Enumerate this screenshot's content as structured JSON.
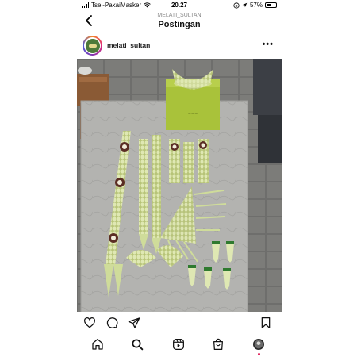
{
  "status_bar": {
    "carrier": "Tsel-PakaiMasker",
    "time": "20.27",
    "battery_text": "57%",
    "battery_level": 0.57
  },
  "header": {
    "subtitle": "MELATI_SULTAN",
    "title": "Postingan"
  },
  "post": {
    "username": "melati_sultan",
    "more_label": "•••",
    "image_subject": "jasmine-flower-bridal-accessories-on-stone-table"
  },
  "icons": {
    "back": "chevron-left-icon",
    "like": "heart-icon",
    "comment": "comment-icon",
    "share": "paper-plane-icon",
    "save": "bookmark-icon",
    "home": "home-icon",
    "search": "search-icon",
    "reels": "reels-icon",
    "shop": "shop-bag-icon",
    "profile": "profile-avatar-icon"
  },
  "colors": {
    "notification_dot": "#e0245e",
    "jasmine_green": "#cfdc9a",
    "box_green": "#a9c23a"
  }
}
